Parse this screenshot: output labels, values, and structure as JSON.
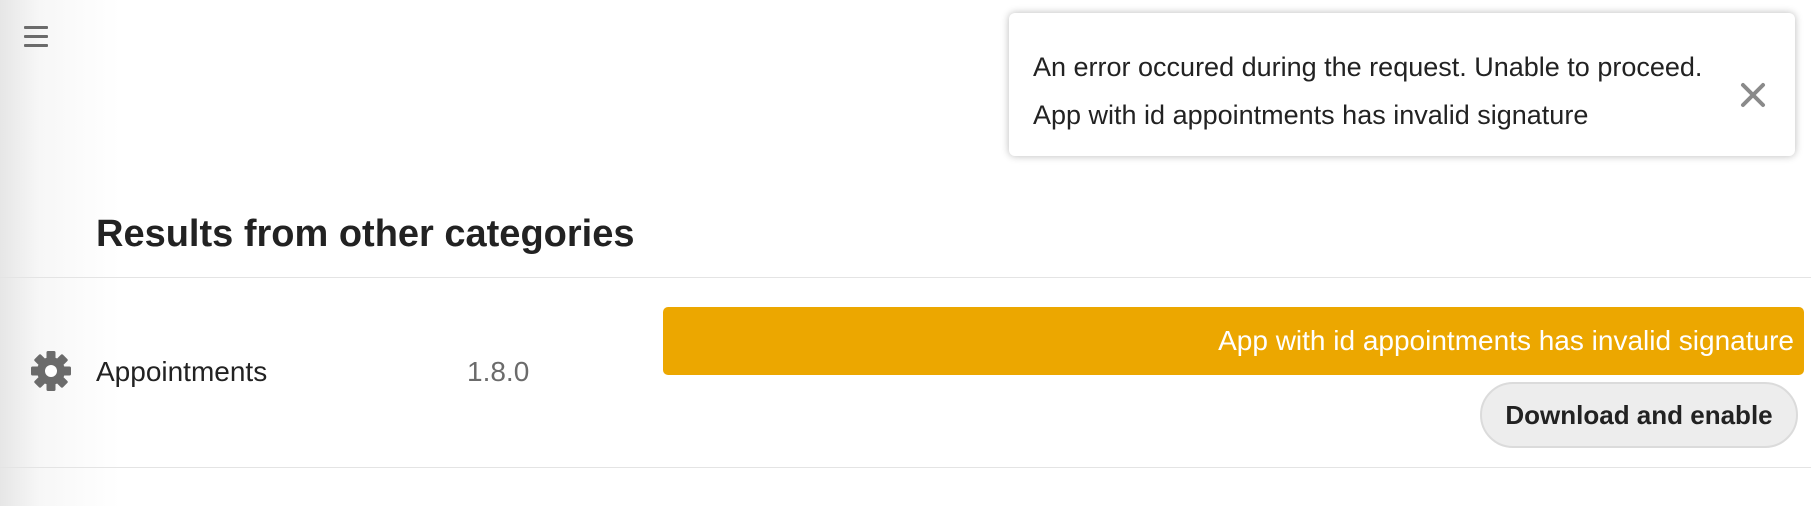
{
  "header": {
    "menu_icon": "hamburger-menu-icon"
  },
  "toast": {
    "message": "An error occured during the request. Unable to proceed.",
    "detail": "App with id appointments has invalid signature",
    "close_icon": "close-icon"
  },
  "section": {
    "title": "Results from other categories"
  },
  "apps": [
    {
      "icon": "gear-icon",
      "name": "Appointments",
      "version": "1.8.0",
      "error": "App with id appointments has invalid signature",
      "action_label": "Download and enable"
    }
  ],
  "colors": {
    "warning": "#eca700",
    "text": "#222222",
    "muted": "#6b6b6b",
    "button_bg": "#ededed"
  }
}
